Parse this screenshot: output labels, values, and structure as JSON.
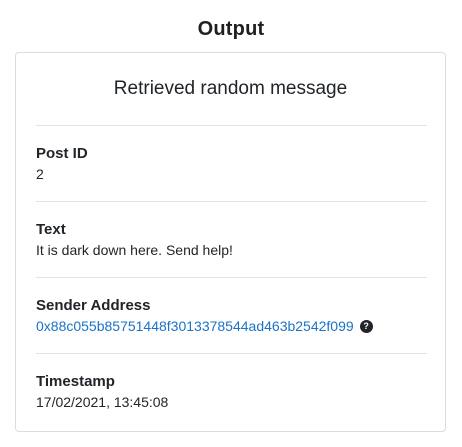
{
  "page": {
    "title": "Output"
  },
  "card": {
    "heading": "Retrieved random message",
    "fields": {
      "post_id": {
        "label": "Post ID",
        "value": "2"
      },
      "text": {
        "label": "Text",
        "value": "It is dark down here. Send help!"
      },
      "sender_address": {
        "label": "Sender Address",
        "value": "0x88c055b85751448f3013378544ad463b2542f099",
        "help_icon": "question-circle-icon",
        "help_glyph": "?"
      },
      "timestamp": {
        "label": "Timestamp",
        "value": "17/02/2021, 13:45:08"
      }
    }
  },
  "colors": {
    "link": "#1a73c7",
    "text": "#212529",
    "border": "#dcdcdc"
  }
}
